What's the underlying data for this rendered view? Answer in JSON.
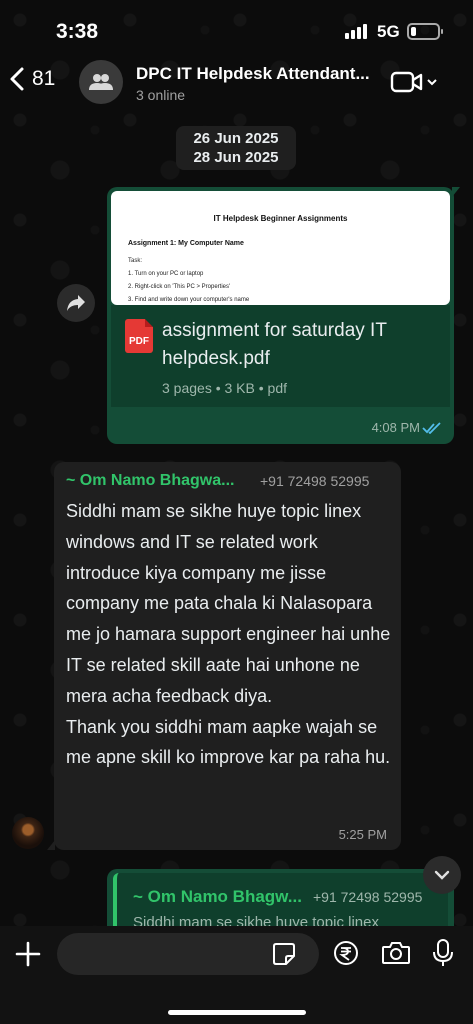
{
  "status_bar": {
    "time": "3:38",
    "network": "5G"
  },
  "header": {
    "back_count": "81",
    "title": "DPC IT Helpdesk Attendant...",
    "subtitle": "3 online"
  },
  "date_chip": {
    "line1": "26 Jun 2025",
    "line2": "28 Jun 2025"
  },
  "pdf_message": {
    "preview": {
      "title": "IT Helpdesk Beginner Assignments",
      "heading": "Assignment 1: My Computer Name",
      "lines": [
        "Task:",
        "1. Turn on your PC or laptop",
        "2. Right-click on 'This PC > Properties'",
        "3. Find and write down your computer's name"
      ]
    },
    "icon_label": "PDF",
    "file_name": "assignment for  saturday IT helpdesk.pdf",
    "meta": "3 pages • 3 KB • pdf",
    "time": "4:08 PM",
    "colors": {
      "bubble": "#144d37",
      "ticks": "#53bdeb"
    }
  },
  "incoming_message": {
    "sender": "~ Om Namo Bhagwa...",
    "phone": "+91 72498 52995",
    "text": "Siddhi mam se sikhe huye topic linex windows and IT se related work introduce kiya company me jisse company me pata chala ki Nalasopara me jo hamara support engineer hai unhe IT se related skill aate hai unhone ne mera acha feedback diya.\nThank you siddhi mam aapke wajah se me apne skill ko improve kar pa raha hu.",
    "time": "5:25 PM",
    "colors": {
      "sender": "#31c46a",
      "bubble": "#1f1f1f"
    }
  },
  "reply_message": {
    "quoted_sender": "~ Om Namo Bhagw...",
    "quoted_phone": "+91 72498 52995",
    "quoted_text": "Siddhi mam se sikhe huye topic linex"
  },
  "composer": {
    "placeholder": ""
  },
  "icons": [
    "back-chevron-icon",
    "group-icon",
    "video-call-icon",
    "forward-icon",
    "scroll-down-icon",
    "plus-icon",
    "sticker-icon",
    "rupee-payment-icon",
    "camera-icon",
    "microphone-icon"
  ]
}
